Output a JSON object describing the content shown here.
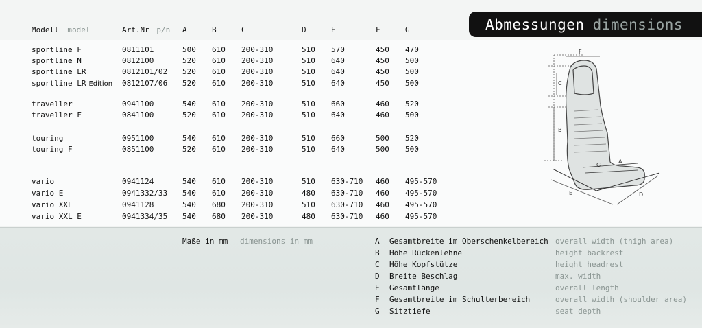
{
  "title": {
    "de": "Abmessungen",
    "en": "dimensions"
  },
  "header": {
    "modell_de": "Modell",
    "modell_en": "model",
    "artnr_de": "Art.Nr",
    "artnr_en": "p/n",
    "cols": [
      "A",
      "B",
      "C",
      "D",
      "E",
      "F",
      "G"
    ]
  },
  "rows": [
    {
      "model": "sportline F",
      "pn": "0811101",
      "A": "500",
      "B": "610",
      "C": "200-310",
      "D": "510",
      "E": "570",
      "F": "450",
      "G": "470"
    },
    {
      "model": "sportline N",
      "pn": "0812100",
      "A": "520",
      "B": "610",
      "C": "200-310",
      "D": "510",
      "E": "640",
      "F": "450",
      "G": "500"
    },
    {
      "model": "sportline LR",
      "pn": "0812101/02",
      "A": "520",
      "B": "610",
      "C": "200-310",
      "D": "510",
      "E": "640",
      "F": "450",
      "G": "500"
    },
    {
      "model": "sportline LR",
      "model_suffix": "Edition",
      "pn": "0812107/06",
      "A": "520",
      "B": "610",
      "C": "200-310",
      "D": "510",
      "E": "640",
      "F": "450",
      "G": "500"
    },
    {
      "model": "traveller",
      "pn": "0941100",
      "A": "540",
      "B": "610",
      "C": "200-310",
      "D": "510",
      "E": "660",
      "F": "460",
      "G": "520"
    },
    {
      "model": "traveller F",
      "pn": "0841100",
      "A": "520",
      "B": "610",
      "C": "200-310",
      "D": "510",
      "E": "640",
      "F": "460",
      "G": "500"
    },
    {
      "model": "touring",
      "pn": "0951100",
      "A": "540",
      "B": "610",
      "C": "200-310",
      "D": "510",
      "E": "660",
      "F": "500",
      "G": "520"
    },
    {
      "model": "touring F",
      "pn": "0851100",
      "A": "520",
      "B": "610",
      "C": "200-310",
      "D": "510",
      "E": "640",
      "F": "500",
      "G": "500"
    },
    {
      "model": "vario",
      "pn": "0941124",
      "A": "540",
      "B": "610",
      "C": "200-310",
      "D": "510",
      "E": "630-710",
      "F": "460",
      "G": "495-570"
    },
    {
      "model": "vario E",
      "pn": "0941332/33",
      "A": "540",
      "B": "610",
      "C": "200-310",
      "D": "480",
      "E": "630-710",
      "F": "460",
      "G": "495-570"
    },
    {
      "model": "vario XXL",
      "pn": "0941128",
      "A": "540",
      "B": "680",
      "C": "200-310",
      "D": "510",
      "E": "630-710",
      "F": "460",
      "G": "495-570"
    },
    {
      "model": "vario XXL E",
      "pn": "0941334/35",
      "A": "540",
      "B": "680",
      "C": "200-310",
      "D": "480",
      "E": "630-710",
      "F": "460",
      "G": "495-570"
    }
  ],
  "units": {
    "de": "Maße in mm",
    "en": "dimensions in mm"
  },
  "legend": [
    {
      "letter": "A",
      "de": "Gesamtbreite im Oberschenkelbereich",
      "en": "overall width (thigh area)"
    },
    {
      "letter": "B",
      "de": "Höhe Rückenlehne",
      "en": "height backrest"
    },
    {
      "letter": "C",
      "de": "Höhe Kopfstütze",
      "en": "height headrest"
    },
    {
      "letter": "D",
      "de": "Breite Beschlag",
      "en": "max. width"
    },
    {
      "letter": "E",
      "de": "Gesamtlänge",
      "en": "overall length"
    },
    {
      "letter": "F",
      "de": "Gesamtbreite im Schulterbereich",
      "en": "overall width (shoulder area)"
    },
    {
      "letter": "G",
      "de": "Sitztiefe",
      "en": "seat depth"
    }
  ],
  "diagram_labels": [
    "F",
    "C",
    "B",
    "G",
    "A",
    "E",
    "D"
  ]
}
